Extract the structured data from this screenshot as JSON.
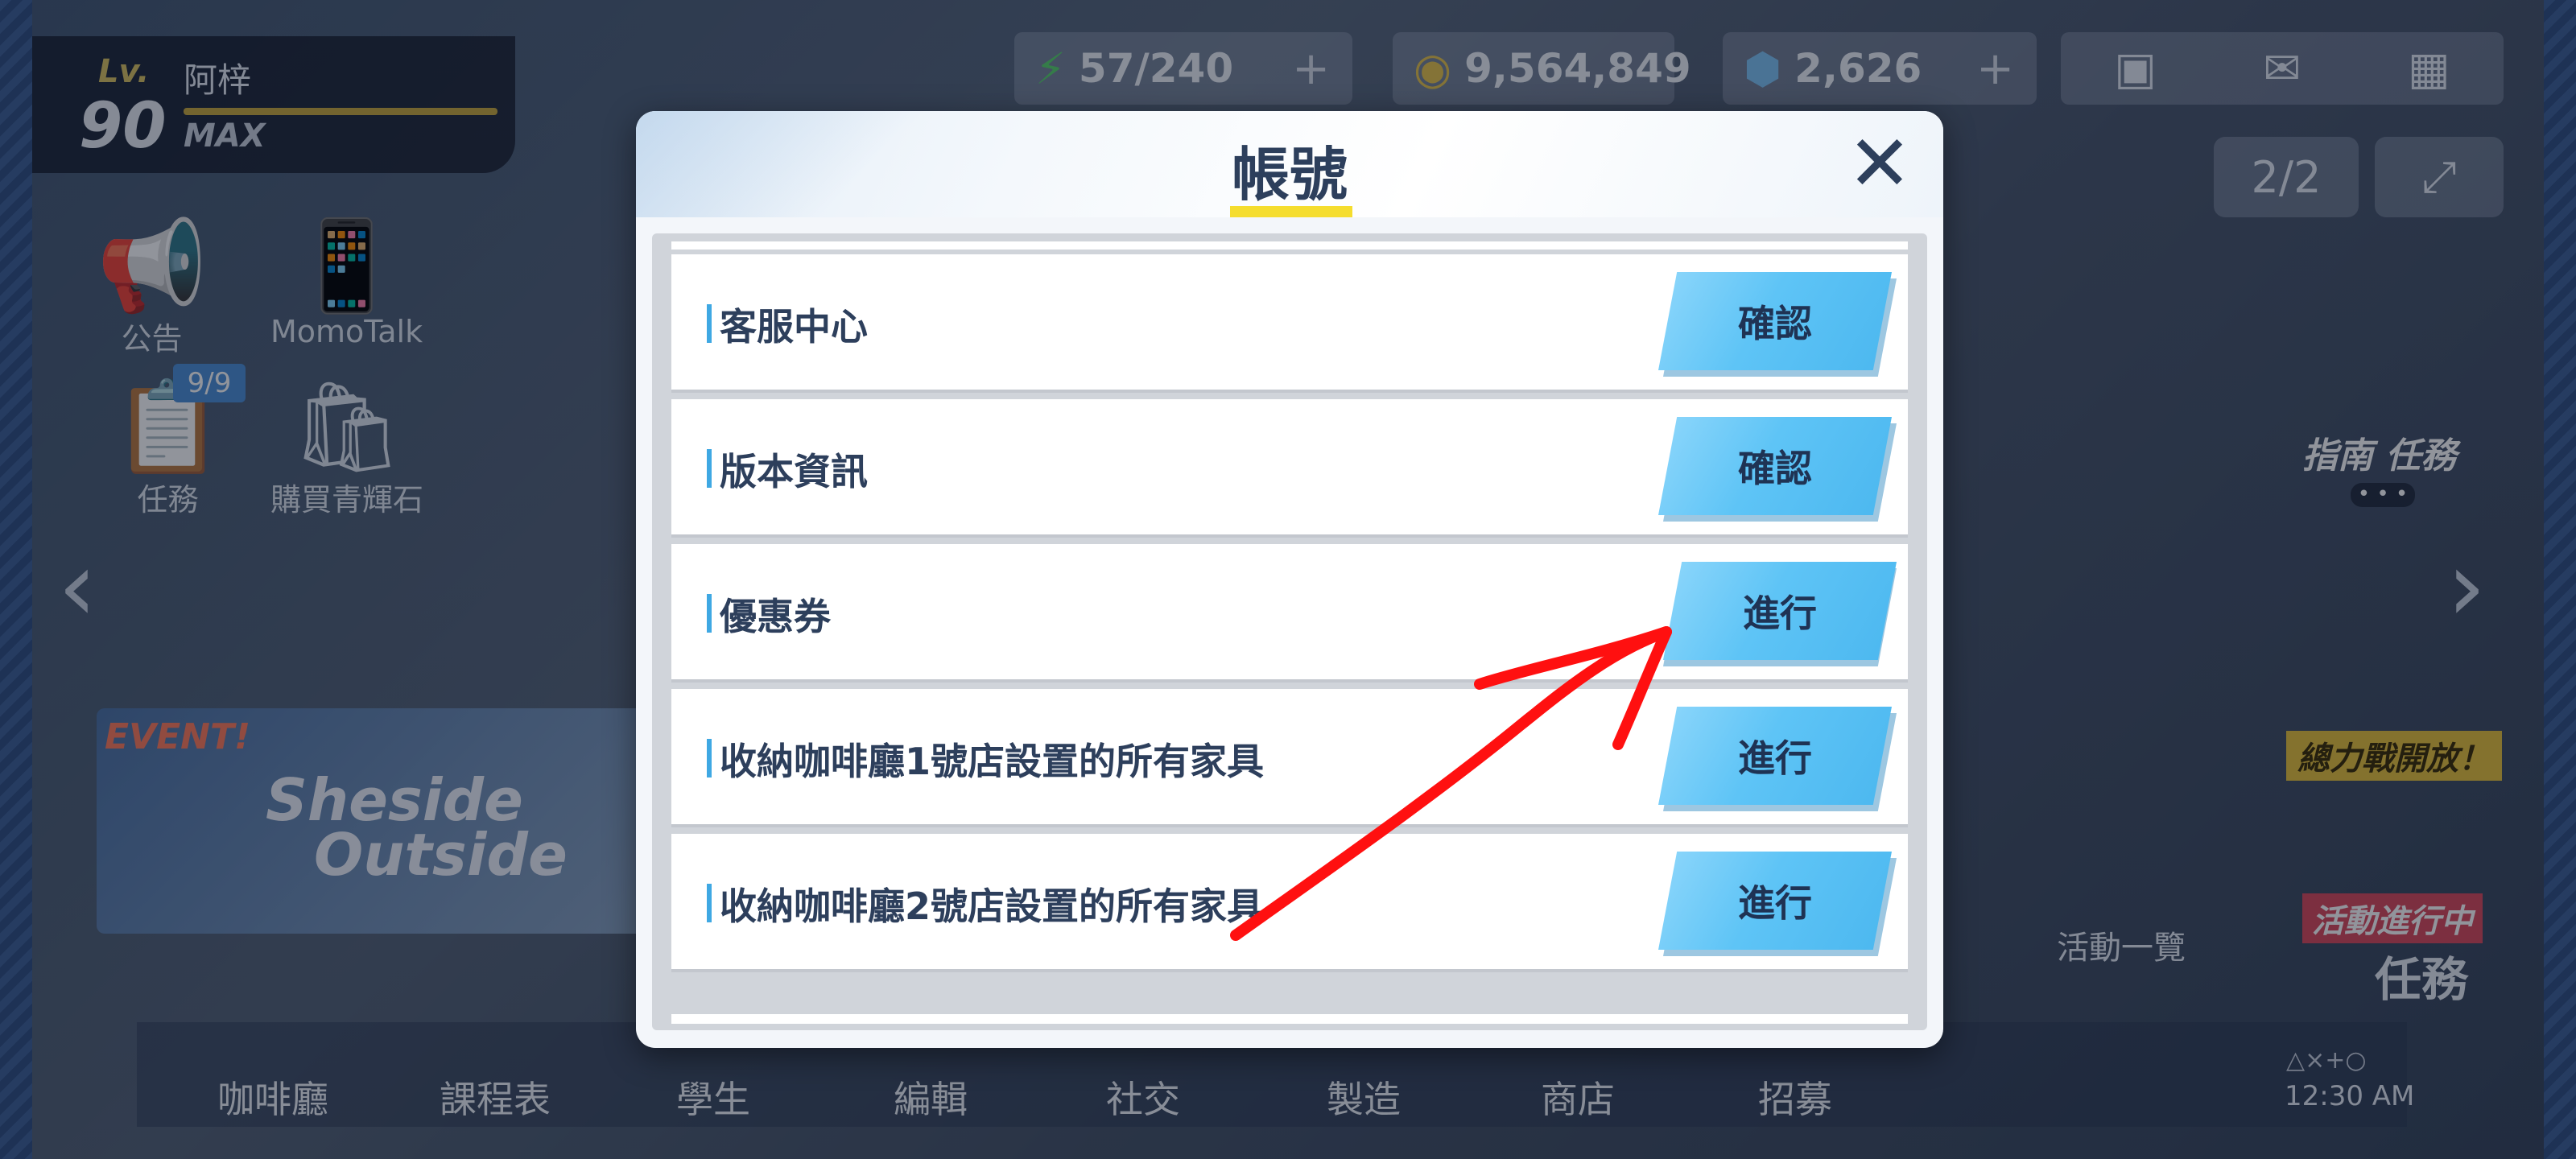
{
  "player": {
    "level_label": "Lv.",
    "level": "90",
    "name": "阿梓",
    "max_label": "MAX"
  },
  "resources": {
    "ap": {
      "icon": "lightning-icon",
      "value": "57/240",
      "plus": "+"
    },
    "credits": {
      "icon": "coin-icon",
      "value": "9,564,849"
    },
    "gems": {
      "icon": "gem-icon",
      "value": "2,626",
      "plus": "+"
    }
  },
  "side_menu": {
    "notice": "公告",
    "momotalk": "MomoTalk",
    "tasks": "任務",
    "tasks_badge": "9/9",
    "buy_gems": "購買青輝石"
  },
  "top_right": {
    "page_indicator": "2/2"
  },
  "event_banner": {
    "tag": "EVENT!",
    "title_line1": "Sheside",
    "title_line2": "Outside"
  },
  "right_panel": {
    "guide": "指南 任務",
    "dots": "• • •",
    "fight_open": "總力戰開放！",
    "activity_list": "活動一覽",
    "activity_running": "活動進行中",
    "task": "任務"
  },
  "bottom_nav": {
    "items": [
      "咖啡廳",
      "課程表",
      "學生",
      "編輯",
      "社交",
      "製造",
      "商店",
      "招募"
    ],
    "clock_symbols": "△×+○",
    "clock": "12:30 AM"
  },
  "modal": {
    "title": "帳號",
    "close": "✕",
    "rows": [
      {
        "label": "客服中心",
        "button": "確認"
      },
      {
        "label": "版本資訊",
        "button": "確認"
      },
      {
        "label": "優惠券",
        "button": "進行"
      },
      {
        "label": "收納咖啡廳1號店設置的所有家具",
        "button": "進行"
      },
      {
        "label": "收納咖啡廳2號店設置的所有家具",
        "button": "進行"
      }
    ]
  },
  "colors": {
    "accent_button": "#5ec4f6",
    "title_underline": "#f5dd2e",
    "row_bar": "#3fa8e3",
    "annotation": "#ff1010"
  }
}
